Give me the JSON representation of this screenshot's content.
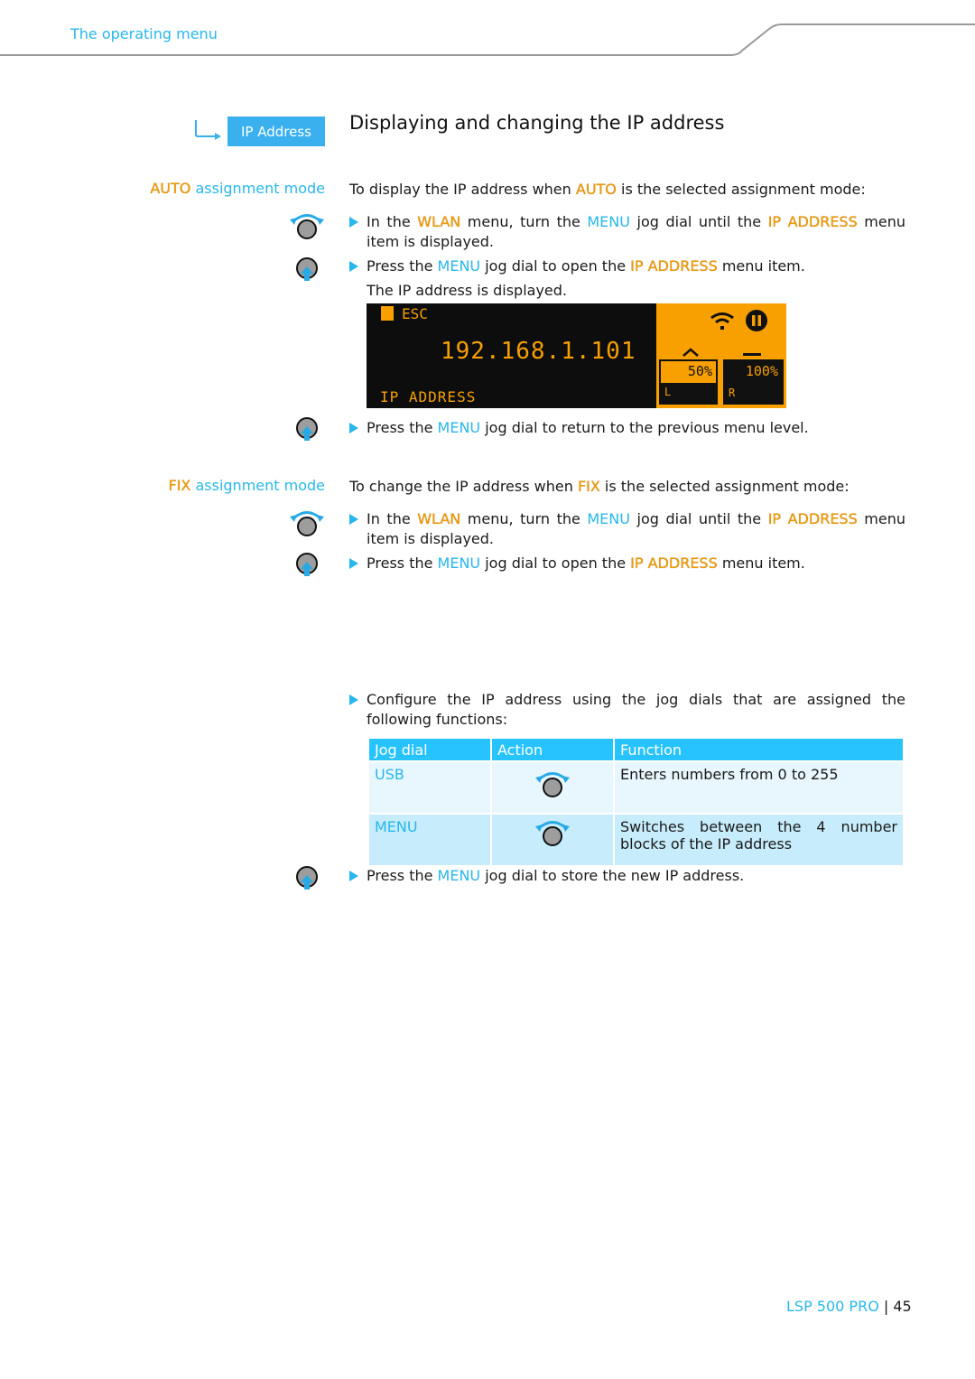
{
  "header": {
    "section_title": "The operating menu"
  },
  "badge": {
    "label": "IP Address"
  },
  "heading": "Displaying and changing the IP address",
  "auto_section": {
    "side_label": {
      "highlight": "AUTO",
      "rest": " assignment mode"
    },
    "intro": {
      "pre": "To display the IP address when ",
      "hl": "AUTO",
      "post": " is the selected assignment mode:"
    },
    "steps": [
      {
        "parts": [
          "In the ",
          "WLAN",
          " menu, turn the ",
          "MENU",
          " jog dial until the ",
          "IP ADDRESS",
          " menu item is displayed."
        ],
        "icon": "jog-dial-turn-icon"
      },
      {
        "parts": [
          "Press the ",
          "MENU",
          " jog dial to open the ",
          "IP ADDRESS",
          " menu item."
        ],
        "icon": "jog-dial-press-icon"
      },
      {
        "parts": [
          "Press the ",
          "MENU",
          " jog dial to return to the previous menu level."
        ],
        "icon": "jog-dial-press-icon"
      }
    ],
    "result_text": "The IP address is displayed."
  },
  "display": {
    "esc_label": "ESC",
    "ip_value": "192.168.1.101",
    "menu_label": "IP ADDRESS",
    "left_level": "50%",
    "right_level": "100%",
    "left_channel": "L",
    "right_channel": "R",
    "colors": {
      "background": "#0d0d0d",
      "accent": "#f7a000"
    }
  },
  "fix_section": {
    "side_label": {
      "highlight": "FIX",
      "rest": " assignment mode"
    },
    "intro": {
      "pre": "To change the IP address when ",
      "hl": "FIX",
      "post": " is the selected assignment mode:"
    },
    "steps": [
      {
        "parts": [
          "In the ",
          "WLAN",
          " menu, turn the ",
          "MENU",
          " jog dial until the ",
          "IP ADDRESS",
          " menu item is displayed."
        ]
      },
      {
        "parts": [
          "Press the ",
          "MENU",
          " jog dial to open the ",
          "IP ADDRESS",
          " menu item."
        ]
      },
      {
        "parts": [
          "Configure the IP address using the jog dials that are assigned the following functions:"
        ]
      },
      {
        "parts": [
          "Press the ",
          "MENU",
          " jog dial to store the new IP address."
        ]
      }
    ]
  },
  "table": {
    "headers": [
      "Jog dial",
      "Action",
      "Function"
    ],
    "rows": [
      {
        "jog_dial": "USB",
        "action_icon": "jog-dial-turn-icon",
        "function": "Enters numbers from 0 to 255"
      },
      {
        "jog_dial": "MENU",
        "action_icon": "jog-dial-turn-icon",
        "function": "Switches between the 4 number blocks of the IP address"
      }
    ]
  },
  "footer": {
    "product": "LSP 500 PRO",
    "separator": "|",
    "page": "45"
  },
  "colors": {
    "accent_blue": "#27b7ea",
    "highlight_orange": "#f09b00",
    "table_header": "#27c3ff"
  }
}
